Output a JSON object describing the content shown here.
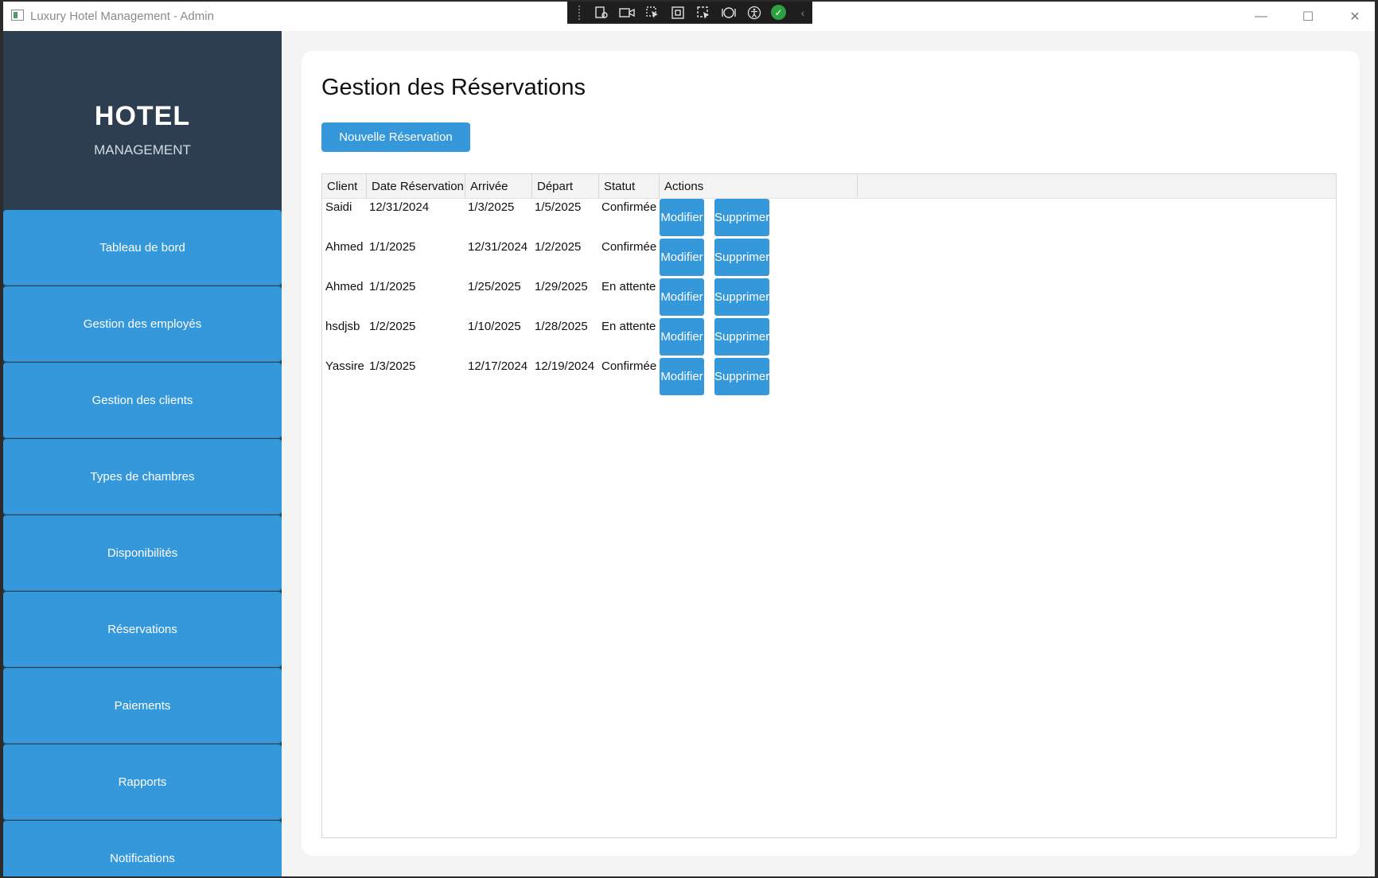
{
  "window": {
    "title": "Luxury Hotel Management - Admin",
    "controls": {
      "minimize": "—",
      "maximize": "☐",
      "close": "✕"
    },
    "toolbar_icons": [
      "live-visual-tree-icon",
      "video-icon",
      "select-element-icon",
      "display-adorners-icon",
      "track-focus-icon",
      "hot-reload-icon",
      "accessibility-icon",
      "check-icon",
      "collapse-icon"
    ]
  },
  "sidebar": {
    "brand_main": "HOTEL",
    "brand_sub": "MANAGEMENT",
    "items": [
      {
        "label": "Tableau de bord"
      },
      {
        "label": "Gestion des employés"
      },
      {
        "label": "Gestion des clients"
      },
      {
        "label": "Types de chambres"
      },
      {
        "label": "Disponibilités"
      },
      {
        "label": "Réservations"
      },
      {
        "label": "Paiements"
      },
      {
        "label": "Rapports"
      },
      {
        "label": "Notifications"
      }
    ]
  },
  "main": {
    "title": "Gestion des Réservations",
    "new_button": "Nouvelle Réservation",
    "table": {
      "columns": [
        "Client",
        "Date Réservation",
        "Arrivée",
        "Départ",
        "Statut",
        "Actions"
      ],
      "rows": [
        {
          "client": "Saidi",
          "date_reservation": "12/31/2024",
          "arrivee": "1/3/2025",
          "depart": "1/5/2025",
          "statut": "Confirmée"
        },
        {
          "client": "Ahmed",
          "date_reservation": "1/1/2025",
          "arrivee": "12/31/2024",
          "depart": "1/2/2025",
          "statut": "Confirmée"
        },
        {
          "client": "Ahmed",
          "date_reservation": "1/1/2025",
          "arrivee": "1/25/2025",
          "depart": "1/29/2025",
          "statut": "En attente"
        },
        {
          "client": "hsdjsb",
          "date_reservation": "1/2/2025",
          "arrivee": "1/10/2025",
          "depart": "1/28/2025",
          "statut": "En attente"
        },
        {
          "client": "Yassire",
          "date_reservation": "1/3/2025",
          "arrivee": "12/17/2024",
          "depart": "12/19/2024",
          "statut": "Confirmée"
        }
      ],
      "edit_label": "Modifier",
      "delete_label": "Supprimer"
    }
  },
  "colors": {
    "sidebar_bg": "#2c3e50",
    "accent": "#3498db",
    "content_bg": "#ffffff",
    "window_bg": "#f4f4f5"
  }
}
